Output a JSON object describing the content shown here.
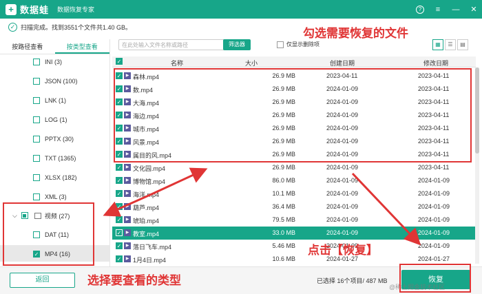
{
  "titlebar": {
    "logo": "+",
    "app_name": "数据蛙",
    "subtitle": "数据恢复专家",
    "controls": [
      "?",
      "≡",
      "—",
      "✕"
    ]
  },
  "status": {
    "text": "扫描完成。找到3551个文件共1.40 GB。"
  },
  "sidebar": {
    "tabs": [
      "按路径查看",
      "按类型查看"
    ],
    "types": [
      "INI (3)",
      "JSON (100)",
      "LNK (1)",
      "LOG (1)",
      "PPTX (30)",
      "TXT (1365)",
      "XLSX (182)",
      "XML (3)"
    ],
    "video_label": "视频 (27)",
    "video_children": [
      "DAT (11)",
      "MP4 (16)"
    ]
  },
  "toolbar": {
    "search_placeholder": "在此处输入文件名称或路径",
    "filter_label": "筛选器",
    "only_deleted_label": "仅显示删除项"
  },
  "table": {
    "headers": [
      "名称",
      "大小",
      "创建日期",
      "修改日期"
    ],
    "rows": [
      {
        "name": "森林.mp4",
        "size": "26.9 MB",
        "created": "2023-04-11",
        "modified": "2023-04-11",
        "checked": true
      },
      {
        "name": "数.mp4",
        "size": "26.9 MB",
        "created": "2024-01-09",
        "modified": "2023-04-11",
        "checked": true
      },
      {
        "name": "大海.mp4",
        "size": "26.9 MB",
        "created": "2024-01-09",
        "modified": "2023-04-11",
        "checked": true
      },
      {
        "name": "海边.mp4",
        "size": "26.9 MB",
        "created": "2024-01-09",
        "modified": "2023-04-11",
        "checked": true
      },
      {
        "name": "城市.mp4",
        "size": "26.9 MB",
        "created": "2024-01-09",
        "modified": "2023-04-11",
        "checked": true
      },
      {
        "name": "风景.mp4",
        "size": "26.9 MB",
        "created": "2024-01-09",
        "modified": "2023-04-11",
        "checked": true
      },
      {
        "name": "属目的风.mp4",
        "size": "26.9 MB",
        "created": "2024-01-09",
        "modified": "2023-04-11",
        "checked": true
      },
      {
        "name": "文化园.mp4",
        "size": "26.9 MB",
        "created": "2024-01-09",
        "modified": "2023-04-11",
        "checked": true
      },
      {
        "name": "博物馆.mp4",
        "size": "86.0 MB",
        "created": "2024-01-09",
        "modified": "2024-01-09",
        "checked": true
      },
      {
        "name": "海洋.mp4",
        "size": "10.1 MB",
        "created": "2024-01-09",
        "modified": "2024-01-09",
        "checked": true
      },
      {
        "name": "葫芦.mp4",
        "size": "36.4 MB",
        "created": "2024-01-09",
        "modified": "2024-01-09",
        "checked": true
      },
      {
        "name": "琥珀.mp4",
        "size": "79.5 MB",
        "created": "2024-01-09",
        "modified": "2024-01-09",
        "checked": true
      },
      {
        "name": "教室.mp4",
        "size": "33.0 MB",
        "created": "2024-01-09",
        "modified": "2024-01-09",
        "checked": true,
        "selected": true
      },
      {
        "name": "落日飞车.mp4",
        "size": "5.46 MB",
        "created": "2024-01-09",
        "modified": "2024-01-09",
        "checked": true
      },
      {
        "name": "1月4日.mp4",
        "size": "10.6 MB",
        "created": "2024-01-27",
        "modified": "2024-01-27",
        "checked": true
      }
    ]
  },
  "footer": {
    "back_label": "返回",
    "selection_status": "已选择 16个项目/ 487 MB",
    "recover_label": "恢复",
    "watermark": "@稀土掘金技术社区"
  },
  "annotations": {
    "select_files": "勾选需要恢复的文件",
    "select_type": "选择要查看的类型",
    "click_recover": "点击【恢复】",
    "color": "#e03535"
  },
  "colors": {
    "accent": "#17a689",
    "selected_row": "#17a689"
  }
}
